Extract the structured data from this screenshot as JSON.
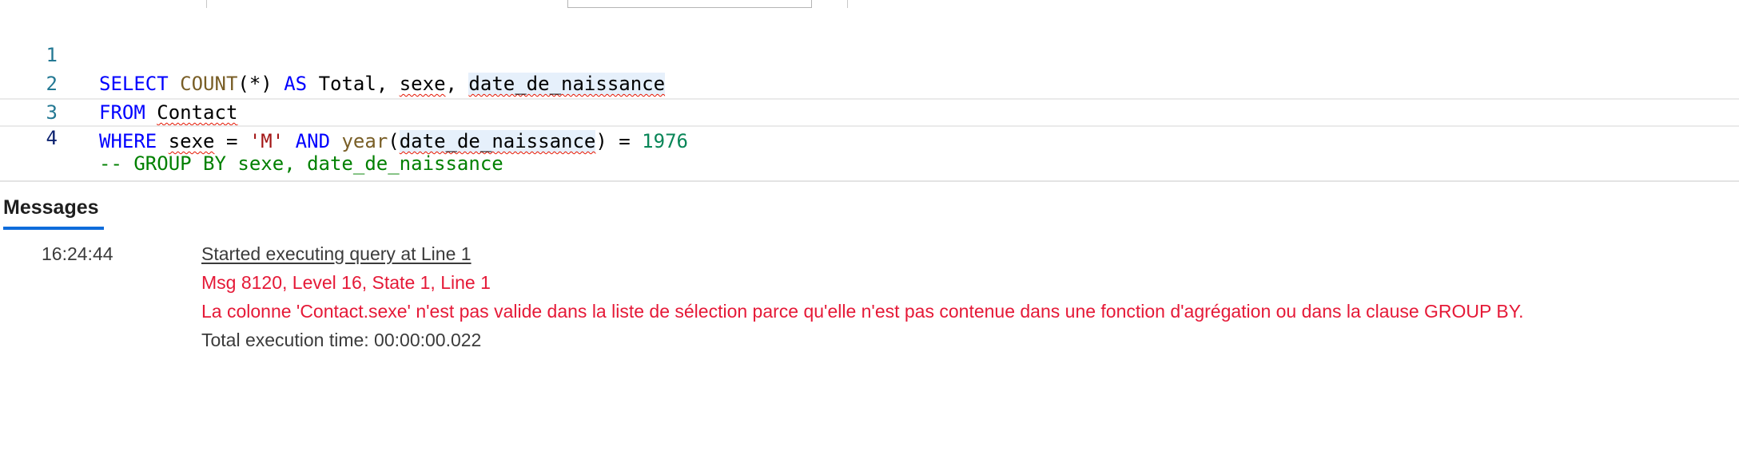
{
  "editor": {
    "lines": [
      {
        "number": "1"
      },
      {
        "number": "2"
      },
      {
        "number": "3"
      },
      {
        "number": "4"
      }
    ],
    "tokens": {
      "l1_select": "SELECT",
      "l1_count": "COUNT",
      "l1_paren": "(*)",
      "l1_as": "AS",
      "l1_total": " Total, ",
      "l1_sexe": "sexe",
      "l1_comma": ", ",
      "l1_date": "date_de_naissance",
      "l2_from": "FROM",
      "l2_contact": "Contact",
      "l3_where": "WHERE",
      "l3_sexe": "sexe",
      "l3_eq": " = ",
      "l3_m": "'M'",
      "l3_and": "AND",
      "l3_year": "year",
      "l3_open": "(",
      "l3_date": "date_de_naissance",
      "l3_close": ") = ",
      "l3_num": "1976",
      "l4_comment": "-- GROUP BY sexe, date_de_naissance"
    }
  },
  "messages": {
    "tab_label": "Messages",
    "time": "16:24:44",
    "lines": [
      "Started executing query at Line 1",
      "Msg 8120, Level 16, State 1, Line 1",
      "La colonne 'Contact.sexe' n'est pas valide dans la liste de sélection parce qu'elle n'est pas contenue dans une fonction d'agrégation ou dans la clause GROUP BY.",
      "Total execution time: 00:00:00.022"
    ]
  },
  "colors": {
    "keyword": "#0000ff",
    "function": "#795e26",
    "string": "#a31515",
    "number": "#098658",
    "comment": "#008000",
    "error": "#e51937",
    "tab_accent": "#0f6cdb"
  }
}
